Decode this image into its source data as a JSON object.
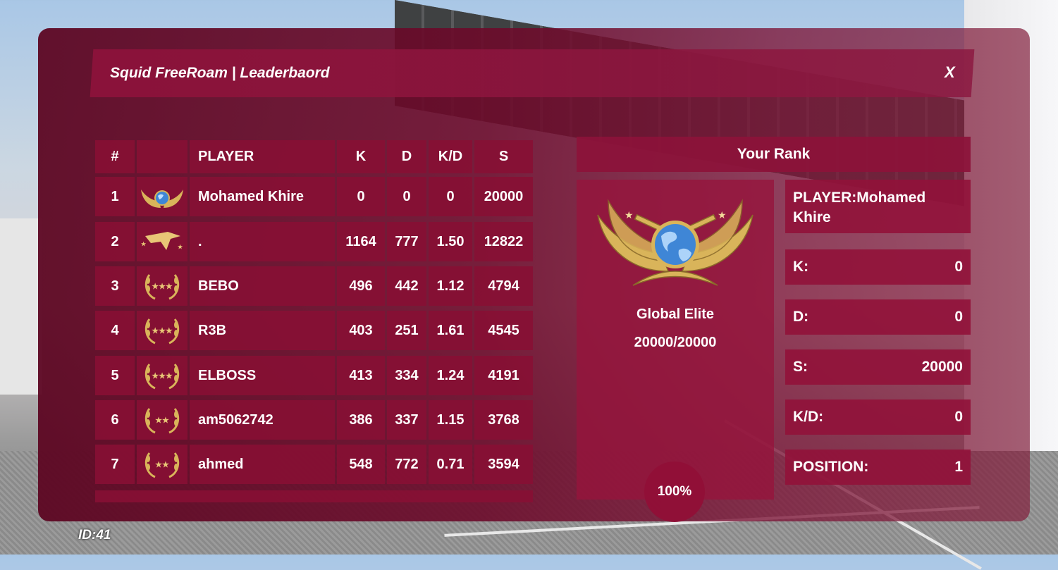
{
  "window": {
    "title": "Squid FreeRoam | Leaderbaord",
    "close_label": "X"
  },
  "table": {
    "headers": [
      "#",
      "",
      "PLAYER",
      "K",
      "D",
      "K/D",
      "S"
    ],
    "rows": [
      {
        "pos": "1",
        "player": "Mohamed Khire",
        "k": "0",
        "d": "0",
        "kd": "0",
        "s": "20000",
        "emblem": "global-elite"
      },
      {
        "pos": "2",
        "player": ".",
        "k": "1164",
        "d": "777",
        "kd": "1.50",
        "s": "12822",
        "emblem": "eagle"
      },
      {
        "pos": "3",
        "player": "BEBO",
        "k": "496",
        "d": "442",
        "kd": "1.12",
        "s": "4794",
        "emblem": "laurel-3-stars"
      },
      {
        "pos": "4",
        "player": "R3B",
        "k": "403",
        "d": "251",
        "kd": "1.61",
        "s": "4545",
        "emblem": "laurel-3-stars"
      },
      {
        "pos": "5",
        "player": "ELBOSS",
        "k": "413",
        "d": "334",
        "kd": "1.24",
        "s": "4191",
        "emblem": "laurel-3-stars"
      },
      {
        "pos": "6",
        "player": "am5062742",
        "k": "386",
        "d": "337",
        "kd": "1.15",
        "s": "3768",
        "emblem": "laurel-2-stars"
      },
      {
        "pos": "7",
        "player": "ahmed",
        "k": "548",
        "d": "772",
        "kd": "0.71",
        "s": "3594",
        "emblem": "laurel-2-stars"
      }
    ]
  },
  "your_rank": {
    "title": "Your Rank",
    "rank_name": "Global Elite",
    "score": "20000/20000",
    "progress_label": "100%",
    "emblem": "global-elite",
    "stats": [
      {
        "label": "PLAYER:Mohamed Khire",
        "value": ""
      },
      {
        "label": "K:",
        "value": "0"
      },
      {
        "label": "D:",
        "value": "0"
      },
      {
        "label": "S:",
        "value": "20000"
      },
      {
        "label": "K/D:",
        "value": "0"
      },
      {
        "label": "POSITION:",
        "value": "1"
      }
    ]
  },
  "footer": {
    "id_label": "ID:41"
  },
  "colors": {
    "panel": "#6c0a2a",
    "row": "#870f34",
    "text": "#ffffff",
    "gold": "#d9b45a",
    "globe": "#3f86d6"
  }
}
